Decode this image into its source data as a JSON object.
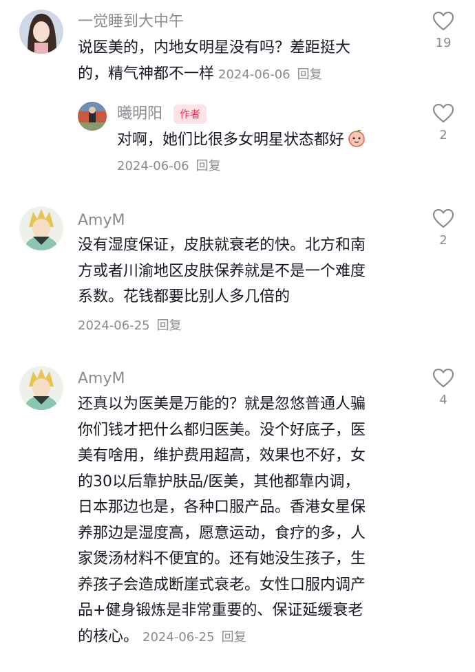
{
  "comments": [
    {
      "username": "一觉睡到大中午",
      "lines": [
        "说医美的，内地女明星没有吗？差距挺大",
        "的，精气神都不一样"
      ],
      "date": "2024-06-06",
      "reply_label": "回复",
      "likes": "19"
    },
    {
      "username": "曦明阳",
      "badge": "作者",
      "lines": [
        "对啊，她们比很多女明星状态都好"
      ],
      "date": "2024-06-06",
      "reply_label": "回复",
      "likes": "2"
    },
    {
      "username": "AmyM",
      "lines": [
        "没有湿度保证，皮肤就衰老的快。北方和南",
        "方或者川渝地区皮肤保养就是不是一个难度",
        "系数。花钱都要比别人多几倍的"
      ],
      "date": "2024-06-25",
      "reply_label": "回复",
      "likes": "2"
    },
    {
      "username": "AmyM",
      "lines": [
        "还真以为医美是万能的？就是忽悠普通人骗",
        "你们钱才把什么都归医美。没个好底子，医",
        "美有啥用，维护费用超高，效果也不好，女",
        "的30以后靠护肤品/医美，其他都靠内调，",
        "日本那边也是，各种口服产品。香港女星保",
        "养那边是湿度高，愿意运动，食疗的多，人",
        "家煲汤材料不便宜的。还有她没生孩子，生",
        "养孩子会造成断崖式衰老。女性口服内调产",
        "品+健身锻炼是非常重要的、保证延缓衰老",
        "的核心。"
      ],
      "date": "2024-06-25",
      "reply_label": "回复",
      "likes": "4"
    }
  ]
}
